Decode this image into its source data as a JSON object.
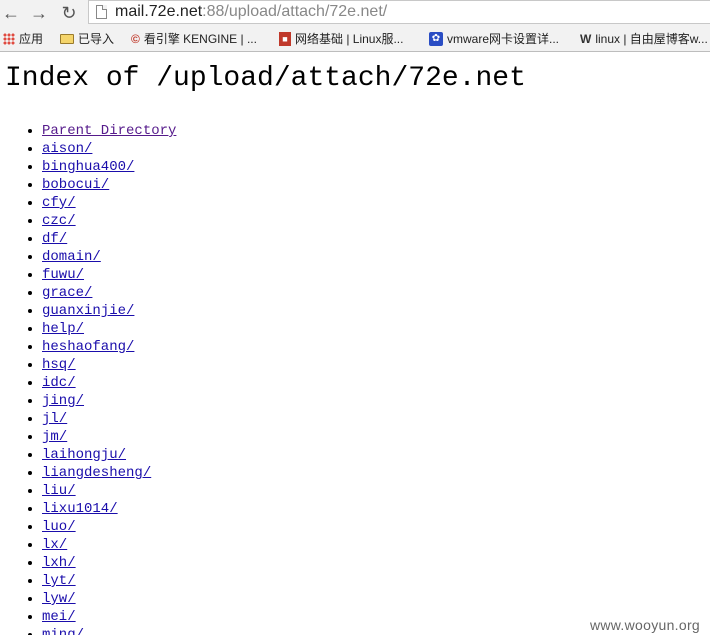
{
  "browser": {
    "url_host": "mail.72e.net",
    "url_rest": ":88/upload/attach/72e.net/",
    "bookmarks": [
      {
        "label": "应用",
        "icon": "apps-grid-icon"
      },
      {
        "label": "已导入",
        "icon": "folder-icon"
      },
      {
        "label": "看引擎 KENGINE | ...",
        "icon": "kengine-logo-icon"
      },
      {
        "label": "网络基础 | Linux服...",
        "icon": "red-site-icon"
      },
      {
        "label": "vmware网卡设置详...",
        "icon": "baidu-paw-icon"
      },
      {
        "label": "linux | 自由屋博客w...",
        "icon": "w-logo-icon"
      }
    ]
  },
  "page": {
    "title": "Index of /upload/attach/72e.net",
    "entries": [
      "Parent Directory",
      "aison/",
      "binghua400/",
      "bobocui/",
      "cfy/",
      "czc/",
      "df/",
      "domain/",
      "fuwu/",
      "grace/",
      "guanxinjie/",
      "help/",
      "heshaofang/",
      "hsq/",
      "idc/",
      "jing/",
      "jl/",
      "jm/",
      "laihongju/",
      "liangdesheng/",
      "liu/",
      "lixu1014/",
      "luo/",
      "lx/",
      "lxh/",
      "lyt/",
      "lyw/",
      "mei/",
      "ming/"
    ]
  },
  "watermark": "www.wooyun.org"
}
